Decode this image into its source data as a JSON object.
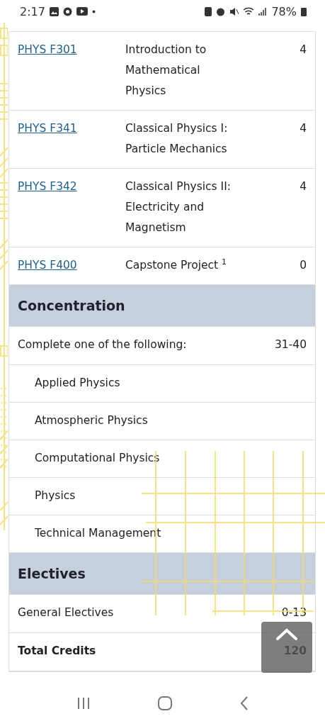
{
  "status_bar": {
    "time": "2:17",
    "battery": "78%"
  },
  "rows": [
    {
      "kind": "course",
      "code": "PHYS F301",
      "title": "Introduction to Mathematical Physics",
      "credits": "4"
    },
    {
      "kind": "course",
      "code": "PHYS F341",
      "title": "Classical Physics I: Particle Mechanics",
      "credits": "4"
    },
    {
      "kind": "course",
      "code": "PHYS F342",
      "title": "Classical Physics II: Electricity and Magnetism",
      "credits": "4"
    },
    {
      "kind": "course",
      "code": "PHYS F400",
      "title": "Capstone Project $^{1}$",
      "credits": "0"
    },
    {
      "kind": "section",
      "title": "Concentration"
    },
    {
      "kind": "row",
      "title": "Complete one of the following:",
      "credits": "31-40"
    },
    {
      "kind": "option",
      "title": "Applied Physics"
    },
    {
      "kind": "option",
      "title": "Atmospheric Physics"
    },
    {
      "kind": "option",
      "title": "Computational Physics"
    },
    {
      "kind": "option",
      "title": "Physics"
    },
    {
      "kind": "option",
      "title": "Technical Management"
    },
    {
      "kind": "section",
      "title": "Electives"
    },
    {
      "kind": "row",
      "title": "General Electives",
      "credits": "0-13"
    },
    {
      "kind": "total",
      "title": "Total Credits",
      "credits": "120"
    }
  ]
}
